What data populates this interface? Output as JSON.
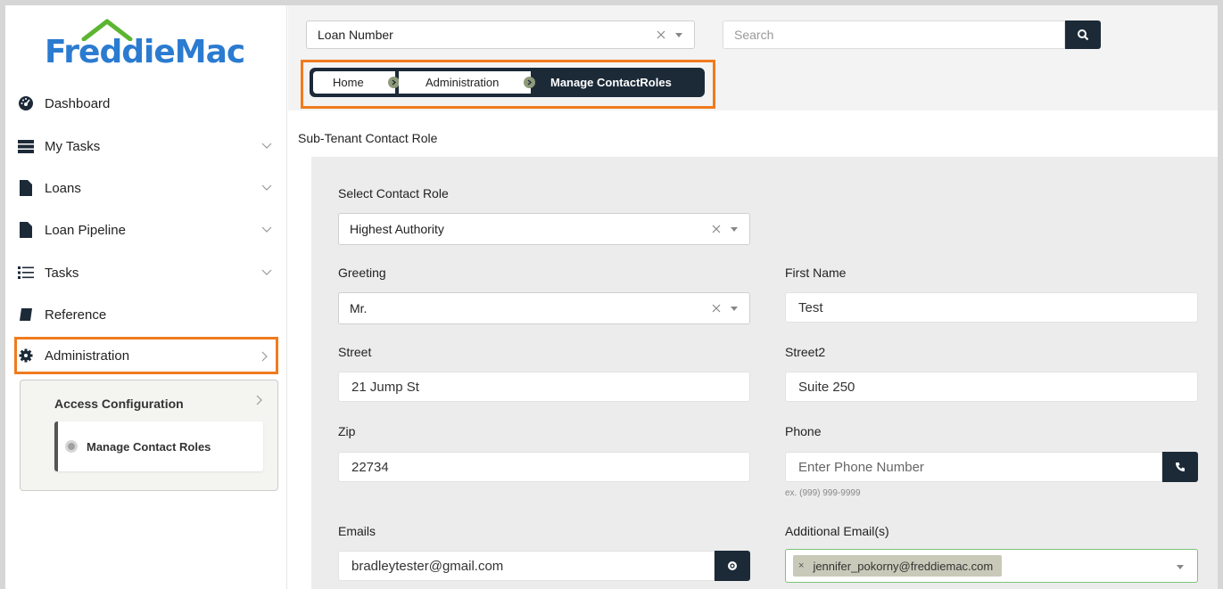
{
  "brand": {
    "name": "FreddieMac",
    "color": "#2b7bd0"
  },
  "sidebar": {
    "items": [
      {
        "label": "Dashboard",
        "icon": "dashboard-icon",
        "chevron": "none"
      },
      {
        "label": "My Tasks",
        "icon": "tasks-list-icon",
        "chevron": "down"
      },
      {
        "label": "Loans",
        "icon": "document-icon",
        "chevron": "down"
      },
      {
        "label": "Loan Pipeline",
        "icon": "document-icon",
        "chevron": "down"
      },
      {
        "label": "Tasks",
        "icon": "list-icon",
        "chevron": "down"
      },
      {
        "label": "Reference",
        "icon": "book-icon",
        "chevron": "none"
      },
      {
        "label": "Administration",
        "icon": "gear-icon",
        "chevron": "right",
        "active": true
      }
    ],
    "submenu": {
      "title": "Access Configuration",
      "items": [
        {
          "label": "Manage Contact Roles"
        }
      ]
    }
  },
  "topbar": {
    "loan_select": {
      "value": "Loan Number"
    },
    "search": {
      "placeholder": "Search"
    }
  },
  "breadcrumb": {
    "home": "Home",
    "admin": "Administration",
    "current": "Manage ContactRoles"
  },
  "page": {
    "section_title": "Sub-Tenant Contact Role",
    "form": {
      "contact_role": {
        "label": "Select Contact Role",
        "value": "Highest Authority"
      },
      "greeting": {
        "label": "Greeting",
        "value": "Mr."
      },
      "first_name": {
        "label": "First Name",
        "value": "Test"
      },
      "street": {
        "label": "Street",
        "value": "21 Jump St"
      },
      "street2": {
        "label": "Street2",
        "value": "Suite 250"
      },
      "zip": {
        "label": "Zip",
        "value": "22734"
      },
      "phone": {
        "label": "Phone",
        "placeholder": "Enter Phone Number",
        "hint": "ex. (999) 999-9999"
      },
      "emails": {
        "label": "Emails",
        "value": "bradleytester@gmail.com"
      },
      "additional_emails": {
        "label": "Additional Email(s)",
        "tags": [
          "jennifer_pokorny@freddiemac.com"
        ]
      }
    }
  },
  "colors": {
    "accent": "#f07b1e",
    "dark": "#1c2a38",
    "panel": "#ececec",
    "valid": "#7cc37a"
  }
}
